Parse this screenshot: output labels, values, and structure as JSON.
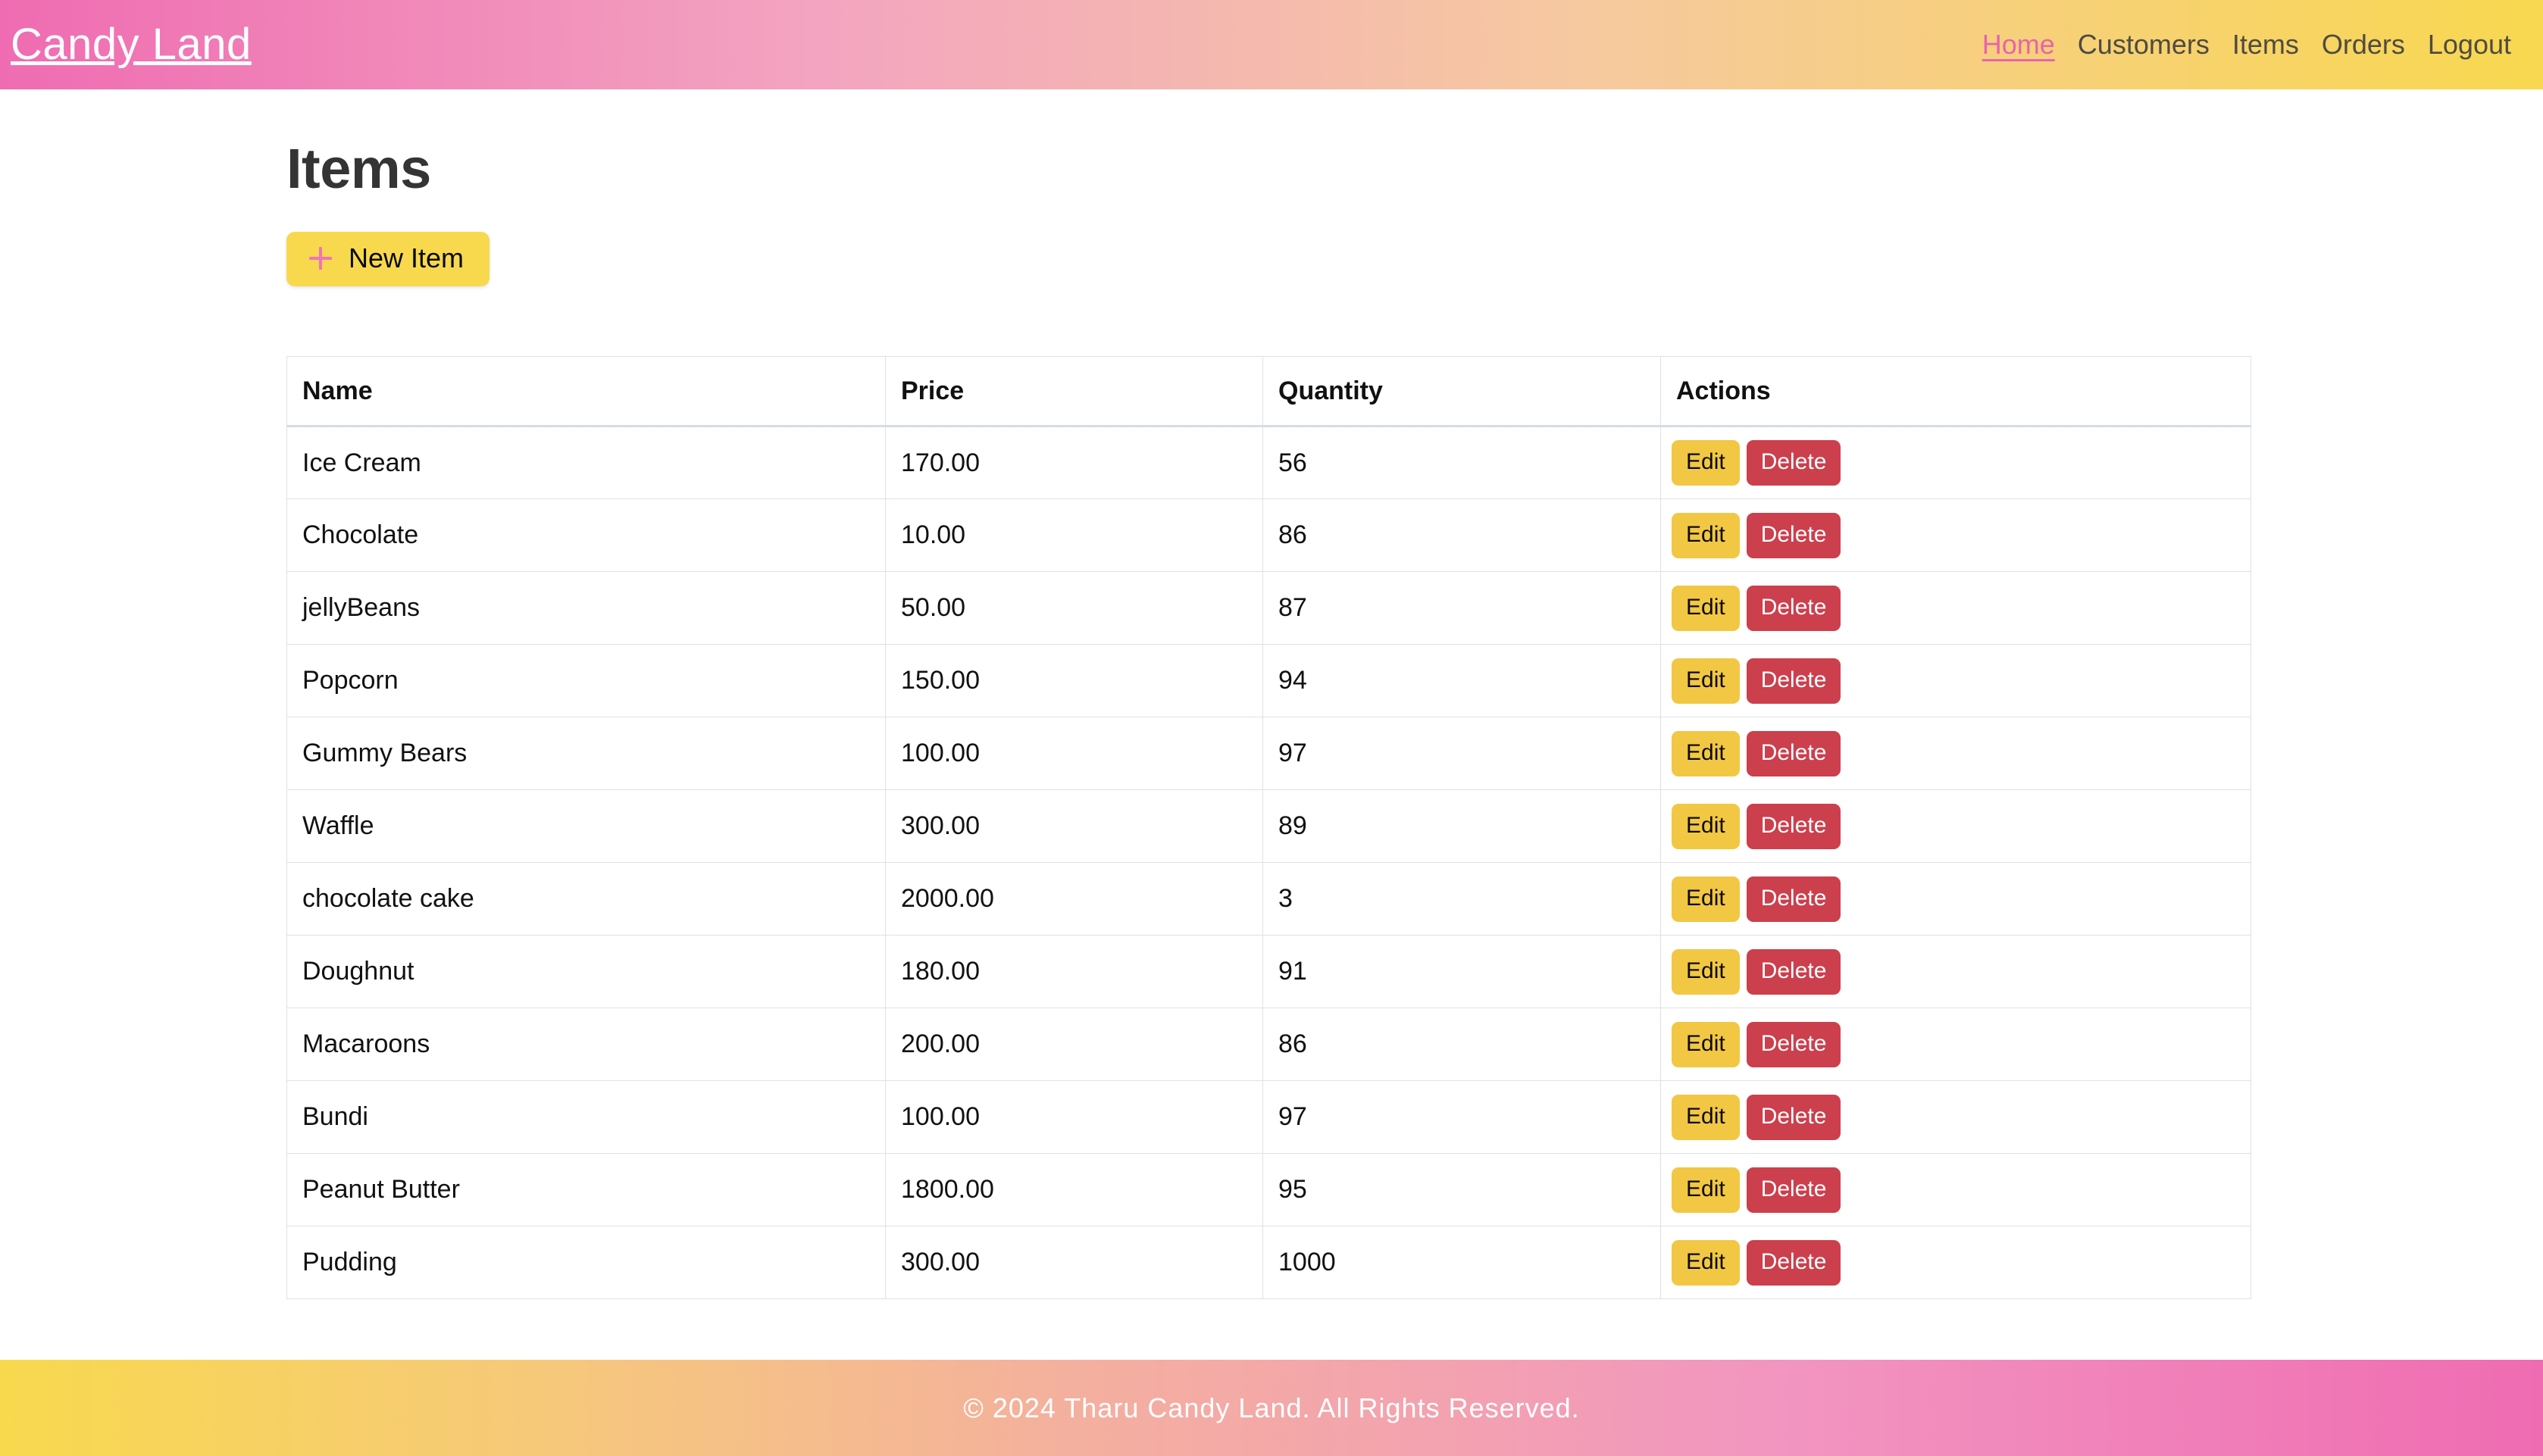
{
  "header": {
    "brand": "Candy Land",
    "nav": [
      {
        "label": "Home",
        "active": true
      },
      {
        "label": "Customers",
        "active": false
      },
      {
        "label": "Items",
        "active": false
      },
      {
        "label": "Orders",
        "active": false
      },
      {
        "label": "Logout",
        "active": false
      }
    ],
    "gradient_from": "#ef6cb2",
    "gradient_to": "#f8d94e",
    "active_link_color": "#e964a9",
    "link_color": "#4f4b42"
  },
  "main": {
    "title": "Items",
    "new_button": {
      "label": "New Item",
      "icon": "plus-icon",
      "bg": "#f8d94e",
      "icon_color": "#f472b6"
    },
    "table": {
      "columns": [
        "Name",
        "Price",
        "Quantity",
        "Actions"
      ],
      "row_actions": {
        "edit": "Edit",
        "delete": "Delete",
        "edit_bg": "#f2c744",
        "delete_bg": "#cc3f4c"
      },
      "rows": [
        {
          "name": "Ice Cream",
          "price": "170.00",
          "quantity": "56"
        },
        {
          "name": "Chocolate",
          "price": "10.00",
          "quantity": "86"
        },
        {
          "name": "jellyBeans",
          "price": "50.00",
          "quantity": "87"
        },
        {
          "name": "Popcorn",
          "price": "150.00",
          "quantity": "94"
        },
        {
          "name": "Gummy Bears",
          "price": "100.00",
          "quantity": "97"
        },
        {
          "name": "Waffle",
          "price": "300.00",
          "quantity": "89"
        },
        {
          "name": "chocolate cake",
          "price": "2000.00",
          "quantity": "3"
        },
        {
          "name": "Doughnut",
          "price": "180.00",
          "quantity": "91"
        },
        {
          "name": "Macaroons",
          "price": "200.00",
          "quantity": "86"
        },
        {
          "name": "Bundi",
          "price": "100.00",
          "quantity": "97"
        },
        {
          "name": "Peanut Butter",
          "price": "1800.00",
          "quantity": "95"
        },
        {
          "name": "Pudding",
          "price": "300.00",
          "quantity": "1000"
        }
      ]
    }
  },
  "footer": {
    "text": "© 2024 Tharu Candy Land. All Rights Reserved.",
    "gradient_from": "#f8d94e",
    "gradient_to": "#ef6cb2"
  }
}
